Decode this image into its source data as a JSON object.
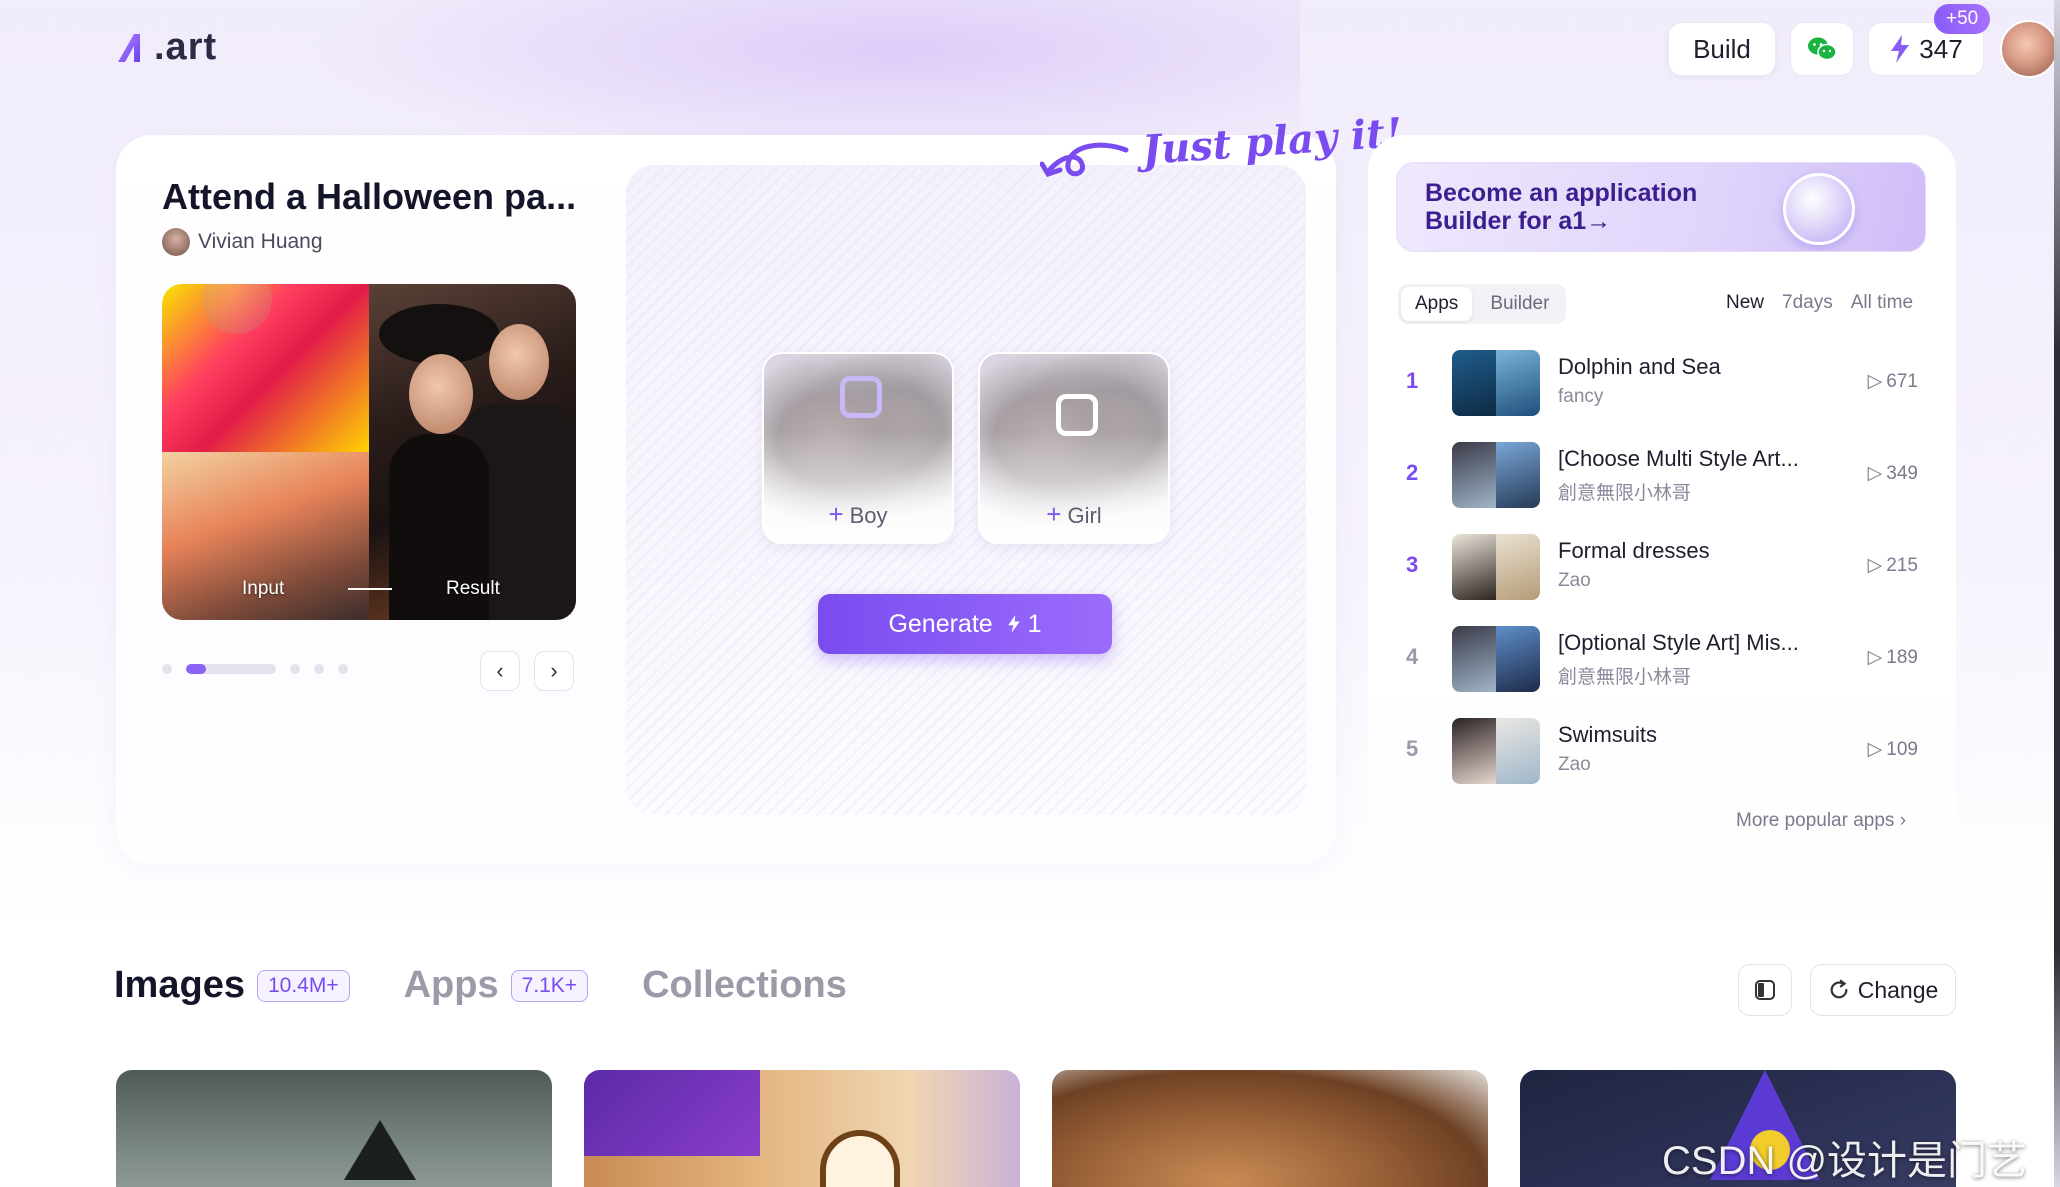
{
  "header": {
    "logo_text": ".art",
    "build_label": "Build",
    "credits_value": "347",
    "credits_bonus": "+50"
  },
  "hero": {
    "just_play": "Just play it!",
    "app_title": "Attend a Halloween pa...",
    "author": "Vivian Huang",
    "input_label": "Input",
    "result_label": "Result",
    "slot_boy": "Boy",
    "slot_girl": "Girl",
    "generate_label": "Generate",
    "generate_cost": "1"
  },
  "ranking": {
    "banner_text": "Become an application Builder for a1→",
    "seg_tabs": [
      "Apps",
      "Builder"
    ],
    "time_filters": [
      "New",
      "7days",
      "All time"
    ],
    "items": [
      {
        "rank": "1",
        "title": "Dolphin and Sea",
        "author": "fancy",
        "plays": "671"
      },
      {
        "rank": "2",
        "title": "[Choose Multi Style Art...",
        "author": "創意無限小林哥",
        "plays": "349"
      },
      {
        "rank": "3",
        "title": "Formal dresses",
        "author": "Zao",
        "plays": "215"
      },
      {
        "rank": "4",
        "title": "[Optional Style Art] Mis...",
        "author": "創意無限小林哥",
        "plays": "189"
      },
      {
        "rank": "5",
        "title": "Swimsuits",
        "author": "Zao",
        "plays": "109"
      }
    ],
    "more_label": "More popular apps"
  },
  "sections": {
    "tabs": [
      {
        "label": "Images",
        "count": "10.4M+"
      },
      {
        "label": "Apps",
        "count": "7.1K+"
      },
      {
        "label": "Collections",
        "count": ""
      }
    ],
    "change_label": "Change"
  },
  "watermark": "CSDN @设计是门艺术",
  "colors": {
    "accent": "#7a4cf0",
    "rank_top": "#7a4cf0",
    "rank_rest": "#9a9aa8"
  }
}
